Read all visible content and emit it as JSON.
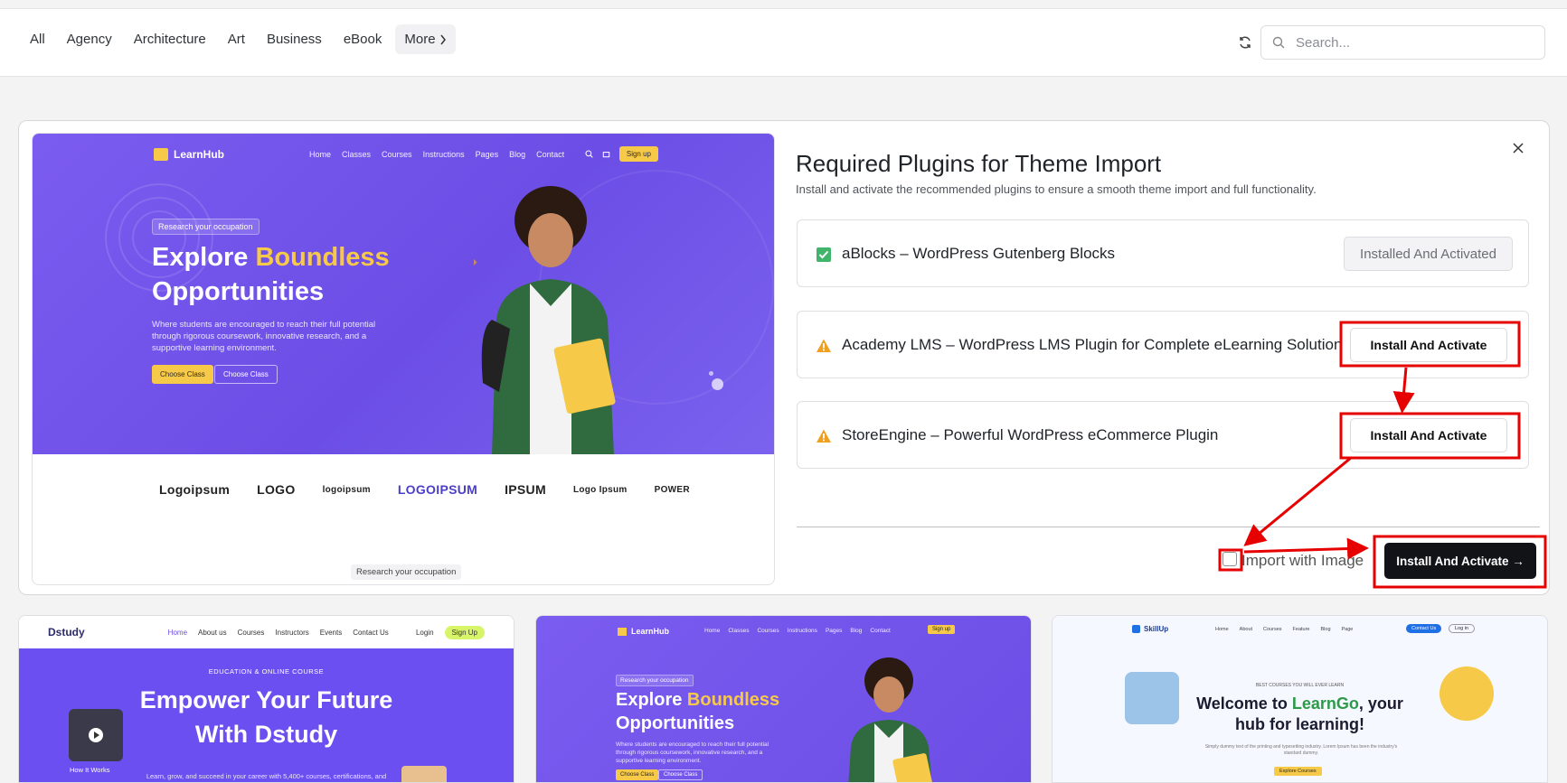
{
  "categories": [
    "All",
    "Agency",
    "Architecture",
    "Art",
    "Business",
    "eBook"
  ],
  "more_label": "More",
  "search": {
    "placeholder": "Search..."
  },
  "modal": {
    "title": "Required Plugins for Theme Import",
    "subtitle": "Install and activate the recommended plugins to ensure a smooth theme import and full functionality.",
    "plugins": [
      {
        "name": "aBlocks – WordPress Gutenberg Blocks",
        "status": "installed",
        "button": "Installed And Activated"
      },
      {
        "name": "Academy LMS – WordPress LMS Plugin for Complete eLearning Solution",
        "status": "warning",
        "button": "Install And Activate"
      },
      {
        "name": "StoreEngine – Powerful WordPress eCommerce Plugin",
        "status": "warning",
        "button": "Install And Activate"
      }
    ],
    "import_with_image_label": "Import with Image",
    "main_button": "Install And Activate →"
  },
  "preview": {
    "logo": "LearnHub",
    "nav": [
      "Home",
      "Classes",
      "Courses",
      "Instructions",
      "Pages",
      "Blog",
      "Contact"
    ],
    "signup": "Sign up",
    "badge": "Research your occupation",
    "title_a": "Explore ",
    "title_highlight": "Boundless",
    "title_b": "Opportunities",
    "desc": "Where students are encouraged to reach their full potential through rigorous coursework, innovative research, and a supportive learning environment.",
    "btn_primary": "Choose Class",
    "btn_secondary": "Choose Class",
    "logos": [
      "Logoipsum",
      "LOGO",
      "logoipsum",
      "LOGOIPSUM",
      "IPSUM",
      "Logo Ipsum",
      "POWER"
    ],
    "footer_label": "Research your occupation"
  },
  "cards": [
    {
      "logo": "Dstudy",
      "nav": [
        "Home",
        "About us",
        "Courses",
        "Instructors",
        "Events",
        "Contact Us"
      ],
      "login": "Login",
      "cta": "Sign Up",
      "eyebrow": "EDUCATION & ONLINE COURSE",
      "title_a": "Empower Your Future",
      "title_b": "With Dstudy",
      "video_label": "How It Works",
      "desc": "Learn, grow, and succeed in your career with 5,400+ courses, certifications, and"
    },
    {
      "logo": "LearnHub",
      "nav": [
        "Home",
        "Classes",
        "Courses",
        "Instructions",
        "Pages",
        "Blog",
        "Contact"
      ],
      "cta": "Sign up",
      "badge": "Research your occupation",
      "title_a": "Explore ",
      "title_highlight": "Boundless",
      "title_b": "Opportunities",
      "desc": "Where students are encouraged to reach their full potential through rigorous coursework, innovative research, and a supportive learning environment.",
      "btn_primary": "Choose Class",
      "btn_secondary": "Choose Class"
    },
    {
      "logo": "SkillUp",
      "nav": [
        "Home",
        "About",
        "Courses",
        "Feature",
        "Blog",
        "Page"
      ],
      "contact": "Contact Us",
      "login": "Log in",
      "pill": "BEST COURSES YOU WILL EVER LEARN",
      "title_a": "Welcome to ",
      "title_highlight": "LearnGo",
      "title_b": ", your",
      "title_c": "hub for learning!",
      "desc": "Simply dummy text of the printing and typesetting industry. Lorem Ipsum has been the industry's standard dummy.",
      "cta": "Explore Courses"
    }
  ],
  "colors": {
    "accent": "#6c4ee6",
    "highlight": "#f7c948",
    "annotation": "#e60000",
    "primary_button": "#121316"
  }
}
